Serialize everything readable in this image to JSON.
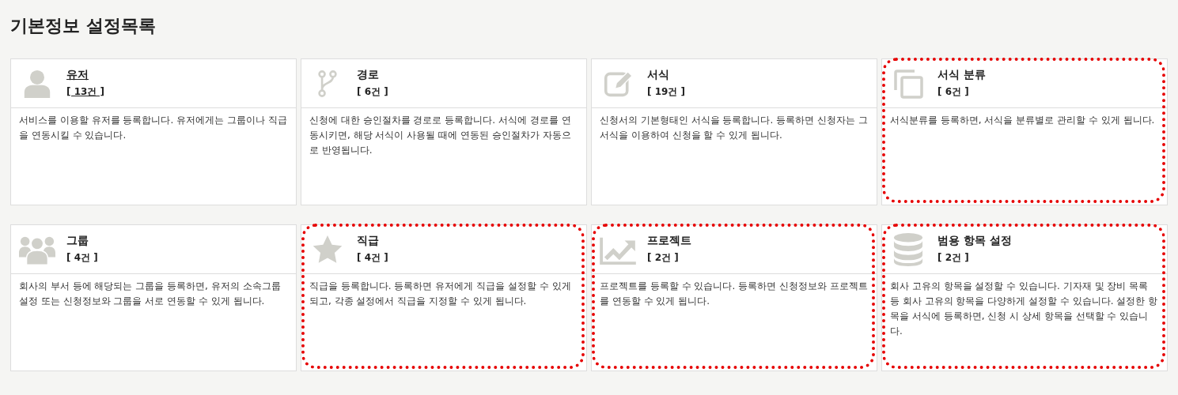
{
  "page_title": "기본정보 설정목록",
  "cards": [
    {
      "title": "유저",
      "count": "[ 13건 ]",
      "description": "서비스를 이용할 유저를 등록합니다. 유저에게는 그룹이나 직급을 연동시킬 수 있습니다.",
      "hovered": true,
      "highlighted": false
    },
    {
      "title": "경로",
      "count": "[ 6건 ]",
      "description": "신청에 대한 승인절차를 경로로 등록합니다. 서식에 경로를 연동시키면, 해당 서식이 사용될 때에 연동된 승인절차가 자동으로 반영됩니다.",
      "hovered": false,
      "highlighted": false
    },
    {
      "title": "서식",
      "count": "[ 19건 ]",
      "description": "신청서의 기본형태인 서식을 등록합니다. 등록하면 신청자는 그 서식을 이용하여 신청을 할 수 있게 됩니다.",
      "hovered": false,
      "highlighted": false
    },
    {
      "title": "서식 분류",
      "count": "[ 6건 ]",
      "description": "서식분류를 등록하면, 서식을 분류별로 관리할 수 있게 됩니다.",
      "hovered": false,
      "highlighted": true
    },
    {
      "title": "그룹",
      "count": "[ 4건 ]",
      "description": "회사의 부서 등에 해당되는 그룹을 등록하면, 유저의 소속그룹 설정 또는 신청정보와 그룹을 서로 연동할 수 있게 됩니다.",
      "hovered": false,
      "highlighted": false
    },
    {
      "title": "직급",
      "count": "[ 4건 ]",
      "description": "직급을 등록합니다. 등록하면 유저에게 직급을 설정할 수 있게 되고, 각종 설정에서 직급을 지정할 수 있게 됩니다.",
      "hovered": false,
      "highlighted": true
    },
    {
      "title": "프로젝트",
      "count": "[ 2건 ]",
      "description": "프로젝트를 등록할 수 있습니다. 등록하면 신청정보와 프로젝트를 연동할 수 있게 됩니다.",
      "hovered": false,
      "highlighted": true
    },
    {
      "title": "범용 항목 설정",
      "count": "[ 2건 ]",
      "description": "회사 고유의 항목을 설정할 수 있습니다. 기자재 및 장비 목록 등 회사 고유의 항목을 다양하게 설정할 수 있습니다. 설정한 항목을 서식에 등록하면, 신청 시 상세 항목을 선택할 수 있습니다.",
      "hovered": false,
      "highlighted": true
    }
  ]
}
